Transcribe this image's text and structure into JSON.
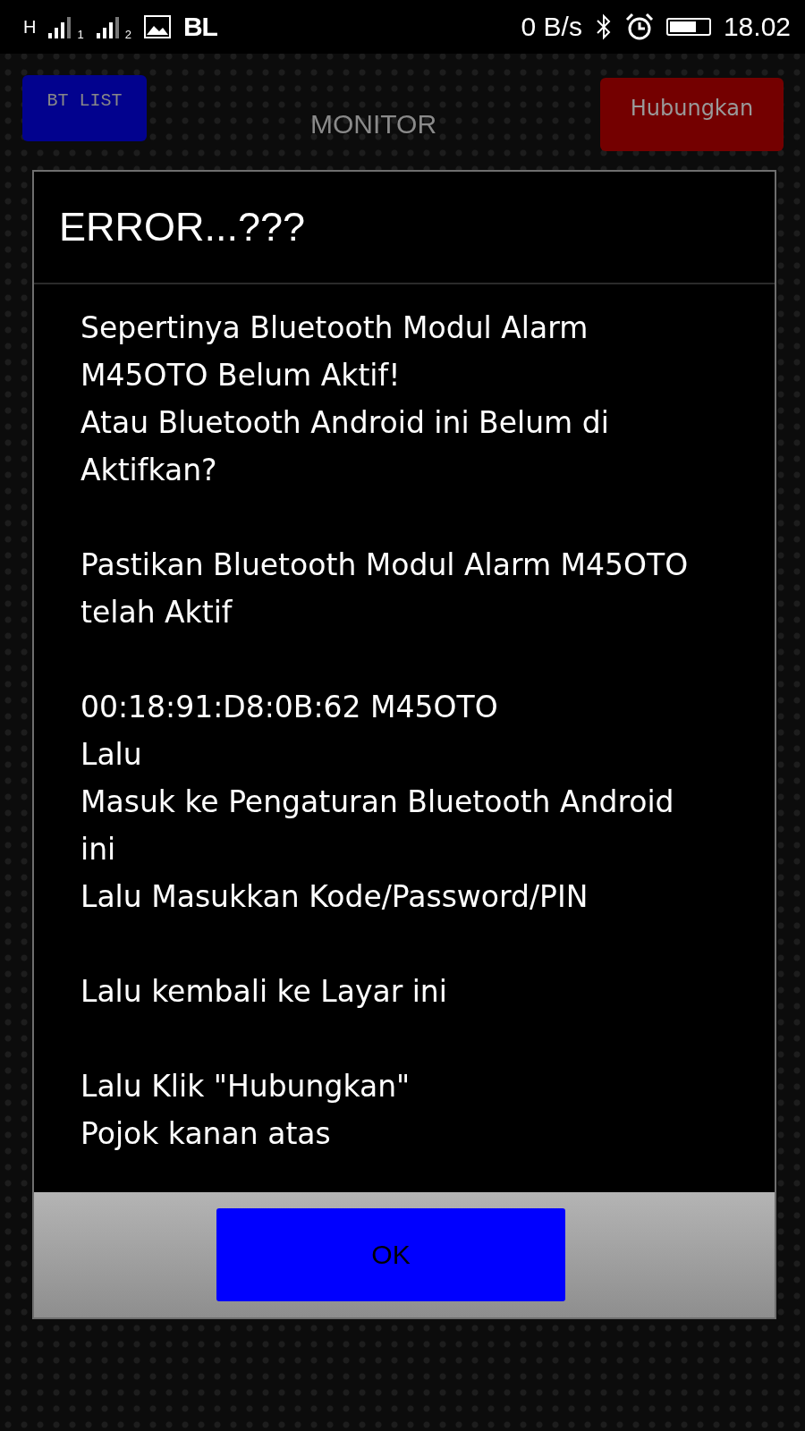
{
  "status_bar": {
    "network_type": "H",
    "sim_slots": [
      "1",
      "2"
    ],
    "carrier_badge": "BL",
    "speed": "0 B/s",
    "time": "18.02"
  },
  "header": {
    "left_button": "BT LIST",
    "title": "MONITOR",
    "right_button": "Hubungkan"
  },
  "dialog": {
    "title": "ERROR...???",
    "paragraphs": [
      [
        "Sepertinya Bluetooth Modul Alarm M45OTO Belum Aktif!",
        "Atau Bluetooth Android ini Belum di Aktifkan?"
      ],
      [
        "Pastikan Bluetooth Modul Alarm M45OTO telah Aktif"
      ],
      [
        "00:18:91:D8:0B:62 M45OTO",
        "Lalu",
        "Masuk ke Pengaturan Bluetooth Android ini",
        "Lalu Masukkan Kode/Password/PIN"
      ],
      [
        "Lalu kembali ke Layar ini"
      ],
      [
        "Lalu Klik \"Hubungkan\"",
        "Pojok kanan atas"
      ]
    ],
    "button": "OK"
  }
}
